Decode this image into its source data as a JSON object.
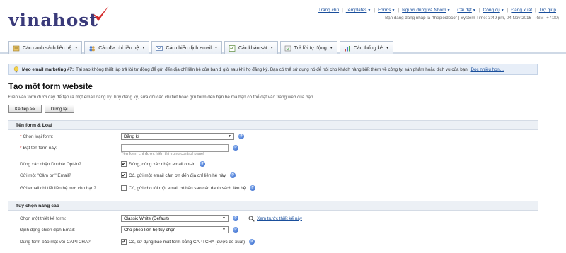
{
  "brand": {
    "logo_text": "vinahost"
  },
  "topnav": {
    "items": [
      {
        "label": "Trang chủ",
        "caret": false
      },
      {
        "label": "Templates",
        "caret": true
      },
      {
        "label": "Forms",
        "caret": true
      },
      {
        "label": "Người dùng và Nhóm",
        "caret": true
      },
      {
        "label": "Cài đặt",
        "caret": true
      },
      {
        "label": "Công cụ",
        "caret": true
      },
      {
        "label": "Đăng xuất",
        "caret": false
      },
      {
        "label": "Trợ giúp",
        "caret": false
      }
    ],
    "login_info": "Bạn đang đăng nhập là \"thegioidoco\" | System Time: 3:49 pm, 04 Nov 2016 - (GMT+7:00)"
  },
  "tabs": [
    {
      "label": "Các danh sách liên hệ",
      "icon": "contacts-icon"
    },
    {
      "label": "Các địa chỉ liên hệ",
      "icon": "users-icon"
    },
    {
      "label": "Các chiến dịch email",
      "icon": "email-icon"
    },
    {
      "label": "Các khảo sát",
      "icon": "survey-icon"
    },
    {
      "label": "Trả lời tự động",
      "icon": "autoresponder-icon"
    },
    {
      "label": "Các thống kê",
      "icon": "stats-icon"
    }
  ],
  "tip": {
    "title": "Mẹo email marketing #7:",
    "text": "Tại sao không thiết lập trả lời tự động để gửi đến địa chỉ liên hệ của bạn 1 giờ sau khi họ đăng ký. Bạn có thể sử dụng nó để nói cho khách hàng biết thêm về công ty, sản phẩm hoặc dịch vụ của bạn.",
    "more": "Đọc nhiều hơn..."
  },
  "page": {
    "title": "Tạo một form website",
    "intro": "Điền vào form dưới đây để tạo ra một email đăng ký, hủy đăng ký, sửa đổi các chi tiết hoặc gửi form đến bạn bè mà bạn có thể đặt vào trang web của bạn.",
    "next_button": "Kế tiếp >>",
    "stop_button": "Dừng lại"
  },
  "section_basic": {
    "heading": "Tên form & Loại",
    "form_type_label": "Chọn loại form:",
    "form_type_value": "Đăng kí",
    "form_name_label": "Đặt tên form này:",
    "form_name_value": "",
    "form_name_hint": "Tên form chỉ được hiển thị trong control panel",
    "double_optin_label": "Dùng xác nhận Double Opt-In?",
    "double_optin_text": "Đúng, dùng xác nhận email opt-in",
    "double_optin_checked": true,
    "thanks_label": "Gửi một \"Cảm ơn\" Email?",
    "thanks_text": "Có, gửi một email cảm ơn đến địa chỉ liên hệ này",
    "thanks_checked": true,
    "copy_label": "Gửi email chi tiết liên hệ mới cho bạn?",
    "copy_text": "Có, gửi cho tôi một email có bản sao các danh sách liên hệ",
    "copy_checked": false
  },
  "section_advanced": {
    "heading": "Tùy chọn nâng cao",
    "design_label": "Chọn một thiết kế form:",
    "design_value": "Classic White (Default)",
    "preview_link": "Xem trước thiết kế này",
    "format_label": "Định dạng chiến dịch Email:",
    "format_value": "Cho phép liên hệ tùy chọn",
    "captcha_label": "Dùng form bảo mật với CAPTCHA?",
    "captcha_text": "Có, sử dụng bảo mật form bằng CAPTCHA (được đề xuất)",
    "captcha_checked": true
  },
  "icons": {
    "help": "?",
    "check": "✔"
  },
  "colors": {
    "link": "#1a4f9c",
    "logo": "#3a3a7a",
    "logo_mark": "#d42a2a",
    "required": "#cc0000"
  }
}
